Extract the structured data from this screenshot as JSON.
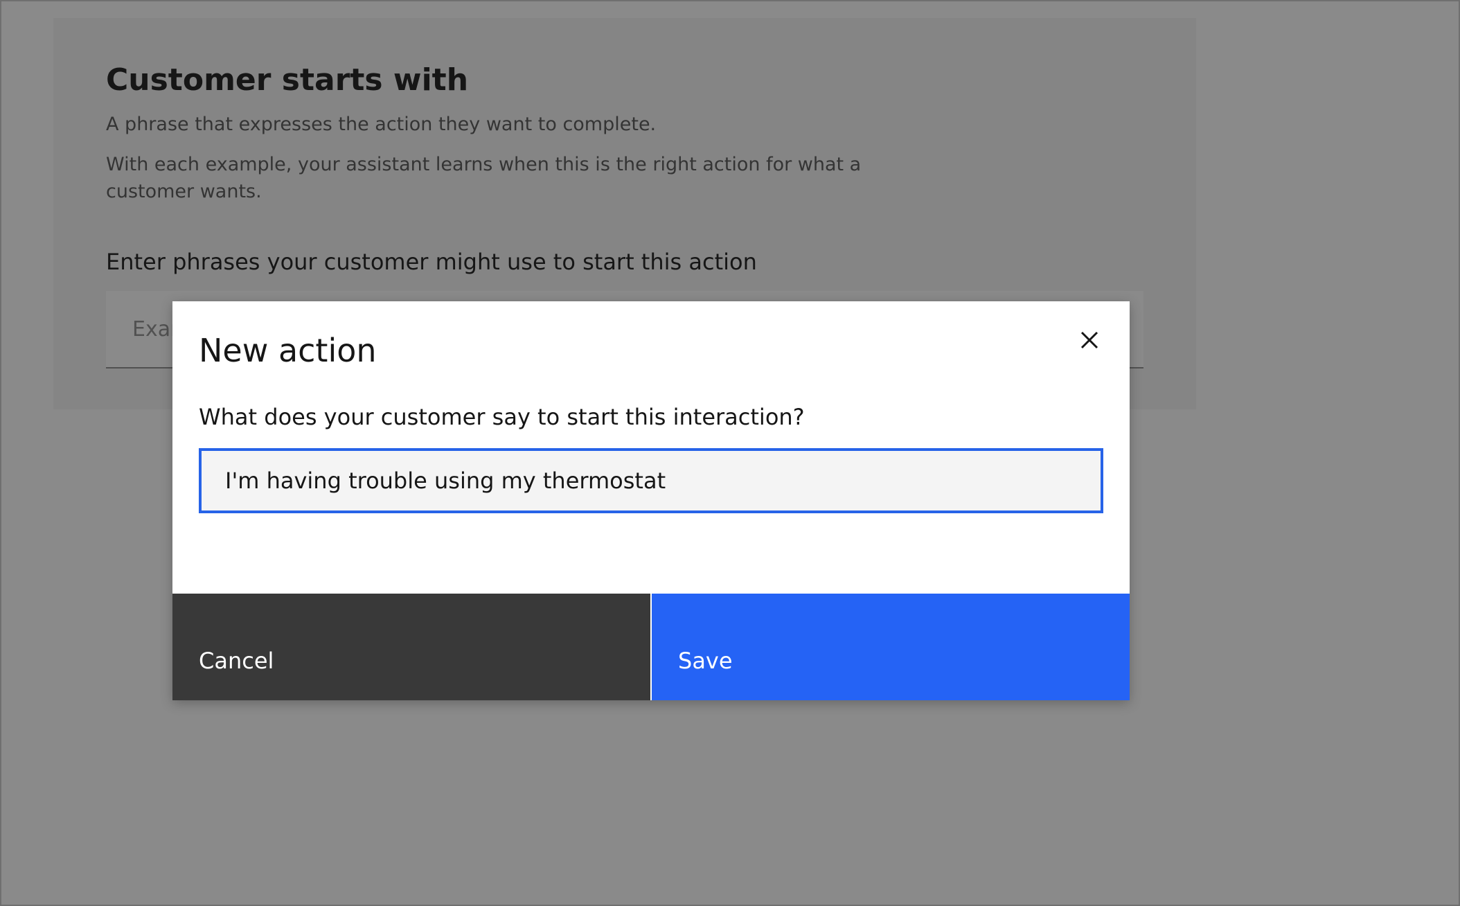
{
  "panel": {
    "title": "Customer starts with",
    "description_1": "A phrase that expresses the action they want to complete.",
    "description_2": "With each example, your assistant learns when this is the right action for what a customer wants.",
    "input_label": "Enter phrases your customer might use to start this action",
    "input_placeholder": "Example: I want to pay my bill"
  },
  "modal": {
    "title": "New action",
    "close_icon": "close-icon",
    "field_label": "What does your customer say to start this interaction?",
    "field_value": "I'm having trouble using my thermostat",
    "cancel_label": "Cancel",
    "save_label": "Save"
  },
  "colors": {
    "primary": "#2563f5",
    "focus_border": "#2763e8",
    "secondary": "#393939",
    "overlay": "rgba(22,22,22,0.5)"
  }
}
